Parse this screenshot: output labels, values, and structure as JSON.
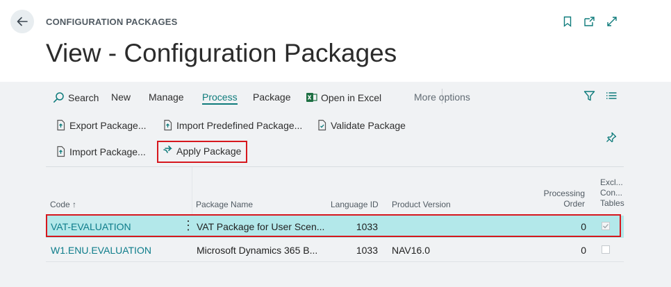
{
  "header": {
    "breadcrumb": "CONFIGURATION PACKAGES",
    "title": "View - Configuration Packages",
    "icons": [
      "bookmark-icon",
      "open-new-window-icon",
      "expand-icon"
    ]
  },
  "actionbar": {
    "search": "Search",
    "new": "New",
    "manage": "Manage",
    "process": "Process",
    "package": "Package",
    "open_in_excel": "Open in Excel",
    "more_options": "More options"
  },
  "subactions": {
    "export_package": "Export Package...",
    "import_predefined": "Import Predefined Package...",
    "validate_package": "Validate Package",
    "import_package": "Import Package...",
    "apply_package": "Apply Package"
  },
  "table": {
    "columns": {
      "code": "Code",
      "code_sort": "↑",
      "package_name": "Package Name",
      "language_id": "Language ID",
      "product_version": "Product Version",
      "processing_order_1": "Processing",
      "processing_order_2": "Order",
      "exclude_1": "Excl...",
      "exclude_2": "Con...",
      "exclude_3": "Tables"
    },
    "rows": [
      {
        "code": "VAT-EVALUATION",
        "package_name": "VAT Package for User Scen...",
        "language_id": "1033",
        "product_version": "",
        "processing_order": "0",
        "exclude": true
      },
      {
        "code": "W1.ENU.EVALUATION",
        "package_name": "Microsoft Dynamics 365 B...",
        "language_id": "1033",
        "product_version": "NAV16.0",
        "processing_order": "0",
        "exclude": false
      }
    ]
  },
  "colors": {
    "accent": "#0e7b7b",
    "selected_row": "#b3e8ea",
    "highlight": "#d6171d",
    "excel_green": "#1d6f42"
  }
}
